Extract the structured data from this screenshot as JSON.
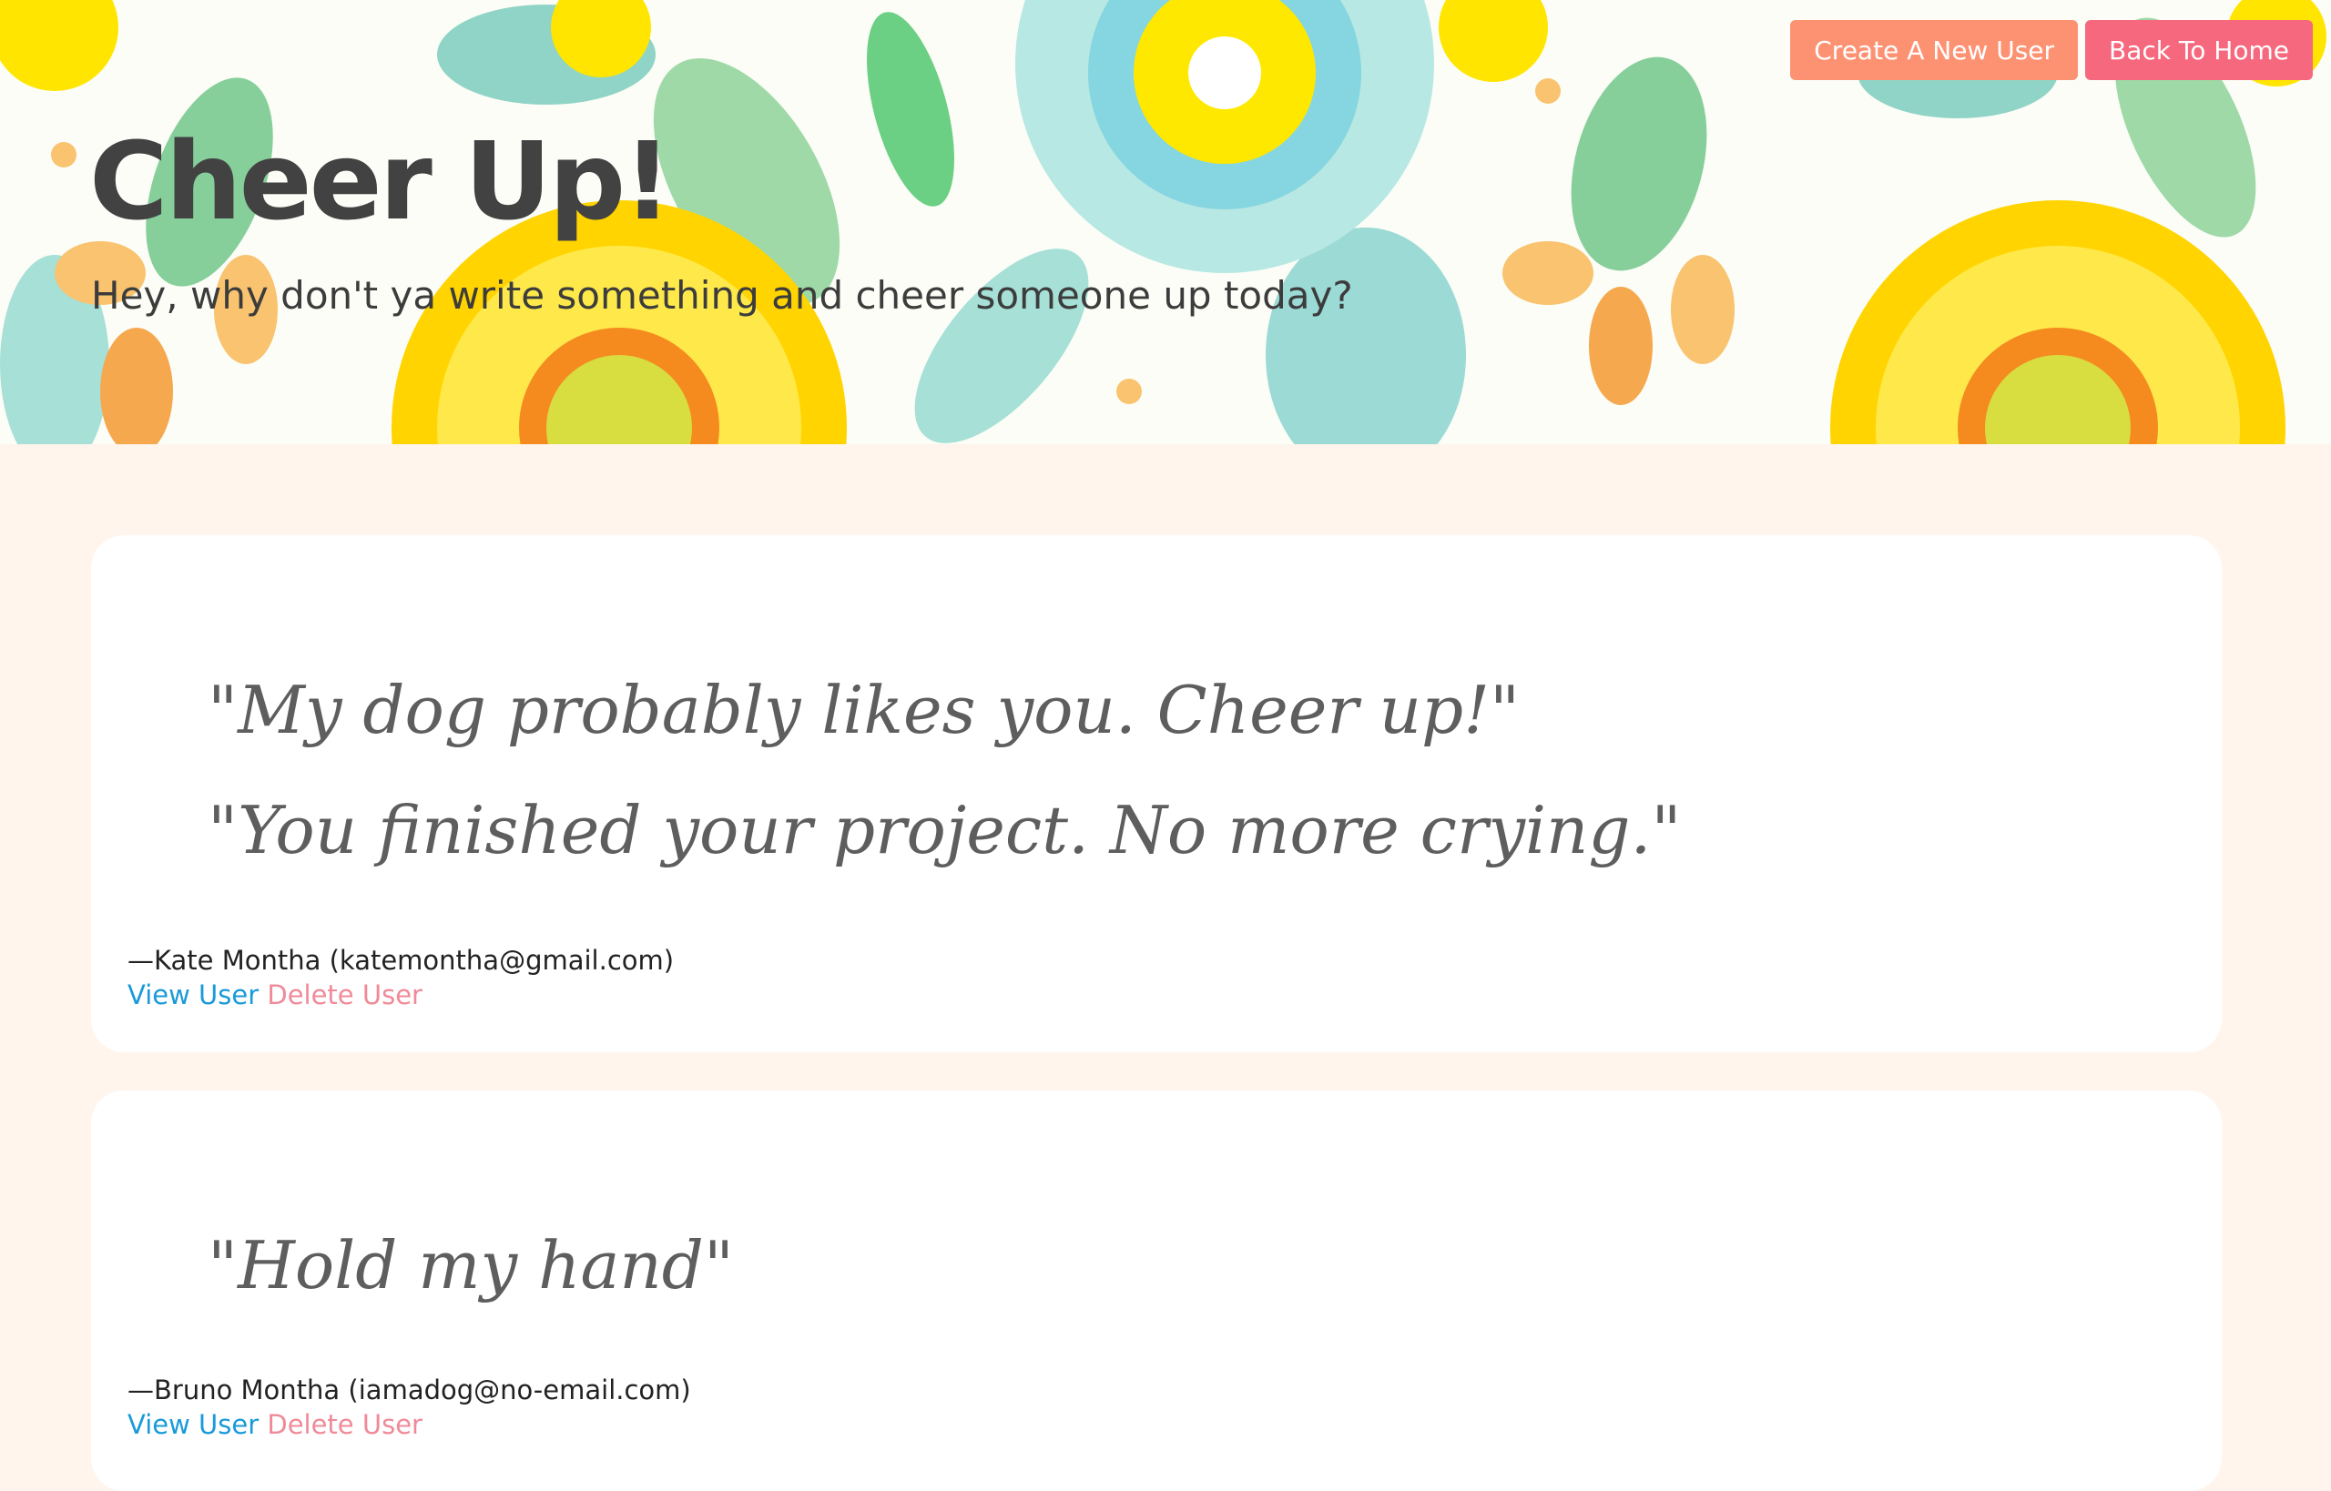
{
  "header": {
    "title": "Cheer Up!",
    "subtitle": "Hey, why don't ya write something and cheer someone up today?"
  },
  "nav": {
    "create_label": "Create A New User",
    "home_label": "Back To Home"
  },
  "cards": [
    {
      "quotes": [
        "\"My dog probably likes you. Cheer up!\"",
        "\"You finished your project. No more crying.\""
      ],
      "author": "—Kate Montha (katemontha@gmail.com)",
      "view_label": "View User",
      "delete_label": "Delete User"
    },
    {
      "quotes": [
        "\"Hold my hand\""
      ],
      "author": "—Bruno Montha (iamadog@no-email.com)",
      "view_label": "View User",
      "delete_label": "Delete User"
    }
  ],
  "colors": {
    "create_button": "#fd9273",
    "home_button": "#f6687d",
    "page_bg": "#fff5ec",
    "view_link": "#1a9ad9",
    "delete_link": "#f08a99"
  }
}
